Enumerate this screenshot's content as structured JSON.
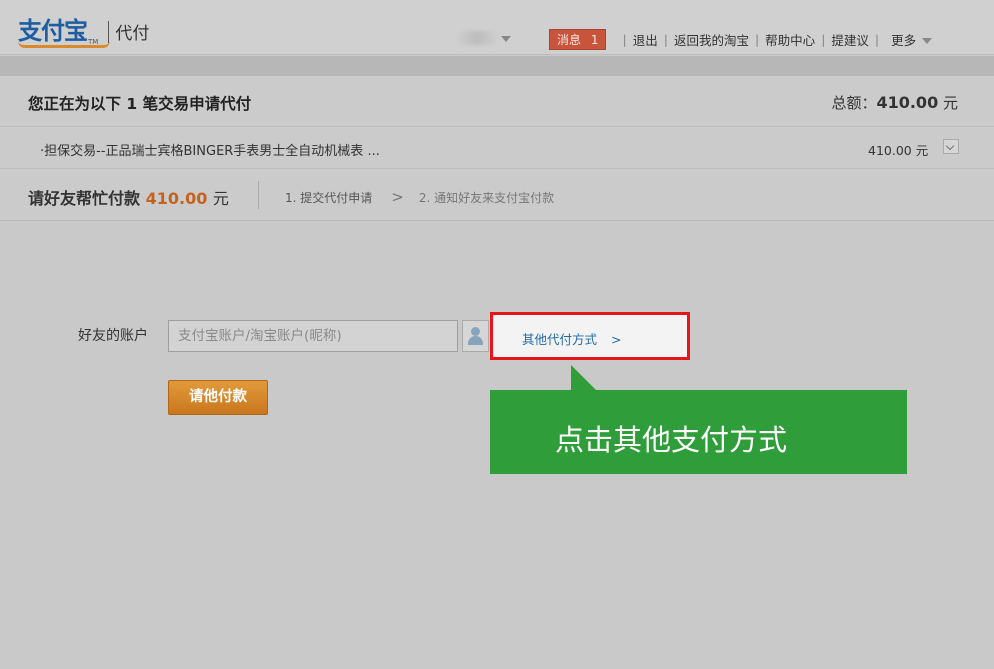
{
  "header": {
    "logo_text": "支付宝",
    "logo_tm": "TM",
    "logo_sub": "代付",
    "nav": {
      "message_label": "消息",
      "message_count": "1",
      "logout": "退出",
      "back_taobao": "返回我的淘宝",
      "help": "帮助中心",
      "suggest": "提建议",
      "more": "更多"
    }
  },
  "order": {
    "title_prefix": "您正在为以下",
    "title_count": "1",
    "title_suffix": "笔交易申请代付",
    "total_label": "总额：",
    "total_amount": "410.00",
    "total_unit": "元",
    "item_title": "·担保交易--正品瑞士宾格BINGER手表男士全自动机械表 ...",
    "item_price": "410.00 元"
  },
  "request": {
    "ask_label": "请好友帮忙付款",
    "amount": "410.00",
    "unit": "元",
    "step1": "1. 提交代付申请",
    "arrow": ">",
    "step2": "2. 通知好友来支付宝付款"
  },
  "form": {
    "friend_label": "好友的账户",
    "account_placeholder": "支付宝账户/淘宝账户(昵称)",
    "other_method_link": "其他代付方式",
    "other_method_arrow": ">",
    "pay_button": "请他付款"
  },
  "callout": {
    "text": "点击其他支付方式",
    "color": "#2f9e3a",
    "highlight_color": "#e8141b"
  },
  "colors": {
    "logo_blue": "#1d5ea3",
    "amount_orange": "#c7621d",
    "badge_red": "#c8543c",
    "link_blue": "#1f6aa8"
  }
}
